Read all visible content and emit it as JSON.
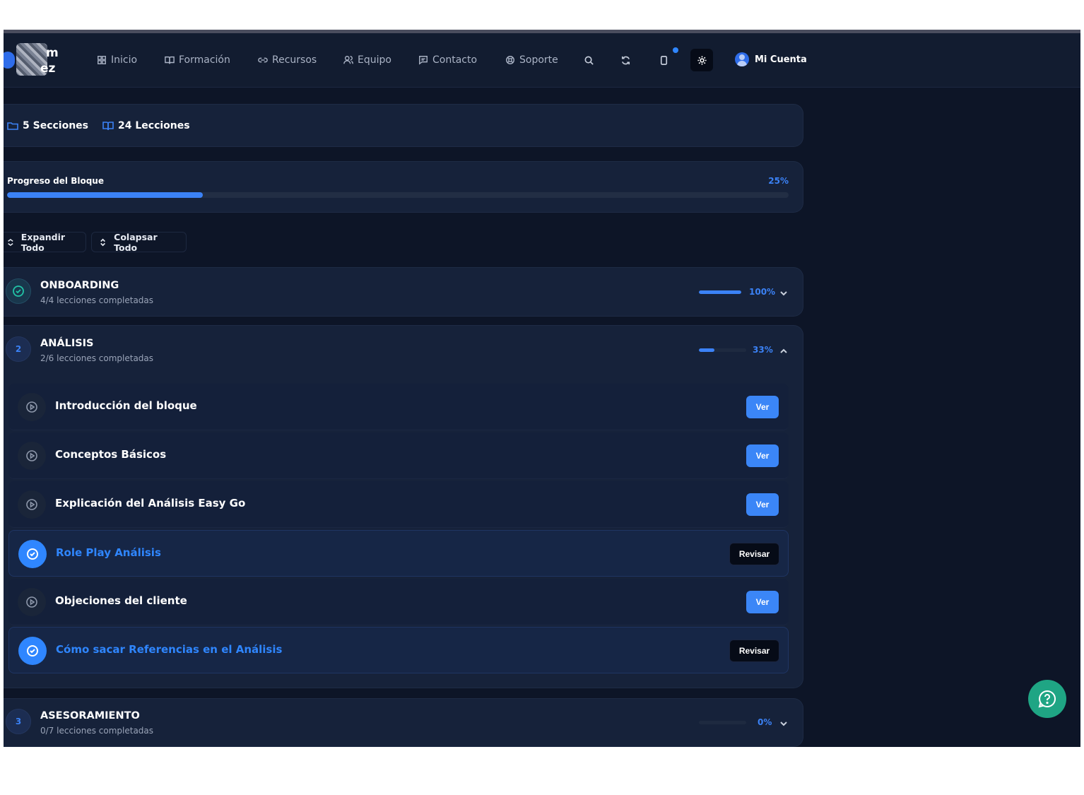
{
  "navbar": {
    "logo_text_line1": "m",
    "logo_text_line2": "ez",
    "items": [
      {
        "label": "Inicio",
        "icon": "grid-icon"
      },
      {
        "label": "Formación",
        "icon": "book-icon"
      },
      {
        "label": "Recursos",
        "icon": "link-icon"
      },
      {
        "label": "Equipo",
        "icon": "users-icon"
      },
      {
        "label": "Contacto",
        "icon": "message-icon"
      },
      {
        "label": "Soporte",
        "icon": "lifebuoy-icon"
      }
    ],
    "account_label": "Mi Cuenta",
    "icons": [
      "search-icon",
      "refresh-icon",
      "phone-icon",
      "sun-icon"
    ]
  },
  "stats": {
    "sections": "5 Secciones",
    "lessons": "24 Lecciones"
  },
  "progress": {
    "label": "Progreso del Bloque",
    "percent_text": "25%",
    "value": 0.25
  },
  "controls": {
    "expand_label": "Expandir Todo",
    "collapse_label": "Colapsar Todo"
  },
  "sections": [
    {
      "number": "",
      "title": "ONBOARDING",
      "subtitle": "4/4 lecciones completadas",
      "percent_text": "100%",
      "value": 1.0,
      "expanded": false,
      "completed": true
    },
    {
      "number": "2",
      "title": "ANÁLISIS",
      "subtitle": "2/6 lecciones completadas",
      "percent_text": "33%",
      "value": 0.33,
      "expanded": true,
      "completed": false
    },
    {
      "number": "3",
      "title": "ASESORAMIENTO",
      "subtitle": "0/7 lecciones completadas",
      "percent_text": "0%",
      "value": 0.0,
      "expanded": false,
      "completed": false
    }
  ],
  "lessons": [
    {
      "title": "Introducción del bloque",
      "action": "Ver",
      "done": false
    },
    {
      "title": "Conceptos Básicos",
      "action": "Ver",
      "done": false
    },
    {
      "title": "Explicación del Análisis Easy Go",
      "action": "Ver",
      "done": false
    },
    {
      "title": "Role Play Análisis",
      "action": "Revisar",
      "done": true
    },
    {
      "title": "Objeciones del cliente",
      "action": "Ver",
      "done": false
    },
    {
      "title": "Cómo sacar Referencias en el Análisis",
      "action": "Revisar",
      "done": true
    }
  ],
  "colors": {
    "background": "#0d1527",
    "panel": "#16223a",
    "accent": "#3b82f6",
    "success": "#22c3a6",
    "help_button": "#1fa584"
  }
}
